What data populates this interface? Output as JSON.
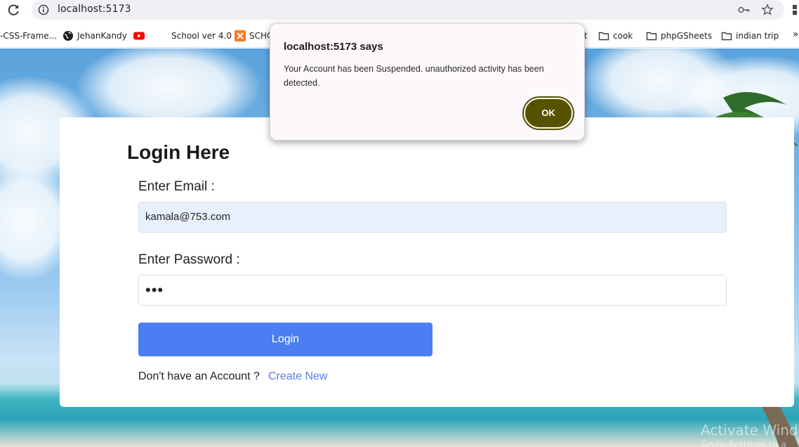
{
  "browser": {
    "url": "localhost:5173",
    "bookmarks": [
      {
        "label": "-CSS-Frame...",
        "icon": "none"
      },
      {
        "label": "JehanKandy",
        "icon": "globe-icon"
      },
      {
        "label": "",
        "icon": "youtube-icon"
      },
      {
        "label": "School ver 4.0",
        "icon": "none"
      },
      {
        "label": "SCHO",
        "icon": "xampp-icon"
      },
      {
        "label": "t",
        "icon": "none"
      },
      {
        "label": "cook",
        "icon": "folder-icon"
      },
      {
        "label": "phpGSheets",
        "icon": "folder-icon"
      },
      {
        "label": "indian trip",
        "icon": "folder-icon"
      }
    ]
  },
  "login": {
    "title": "Login Here",
    "email_label": "Enter Email :",
    "email_value": "kamala@753.com",
    "password_label": "Enter Password :",
    "password_mask": "•••",
    "login_button": "Login",
    "no_account_text": "Don't have an Account ?",
    "create_link": "Create New"
  },
  "dialog": {
    "title": "localhost:5173 says",
    "message": "Your Account has been Suspended. unauthorized activity has been detected.",
    "ok_label": "OK"
  },
  "watermark": {
    "line1": "Activate Windo",
    "line2": "Go to Settings to a"
  },
  "colors": {
    "login_button": "#4a7ef2",
    "ok_button": "#565200",
    "link": "#5a7de8",
    "autofill": "#e8f0fe"
  }
}
